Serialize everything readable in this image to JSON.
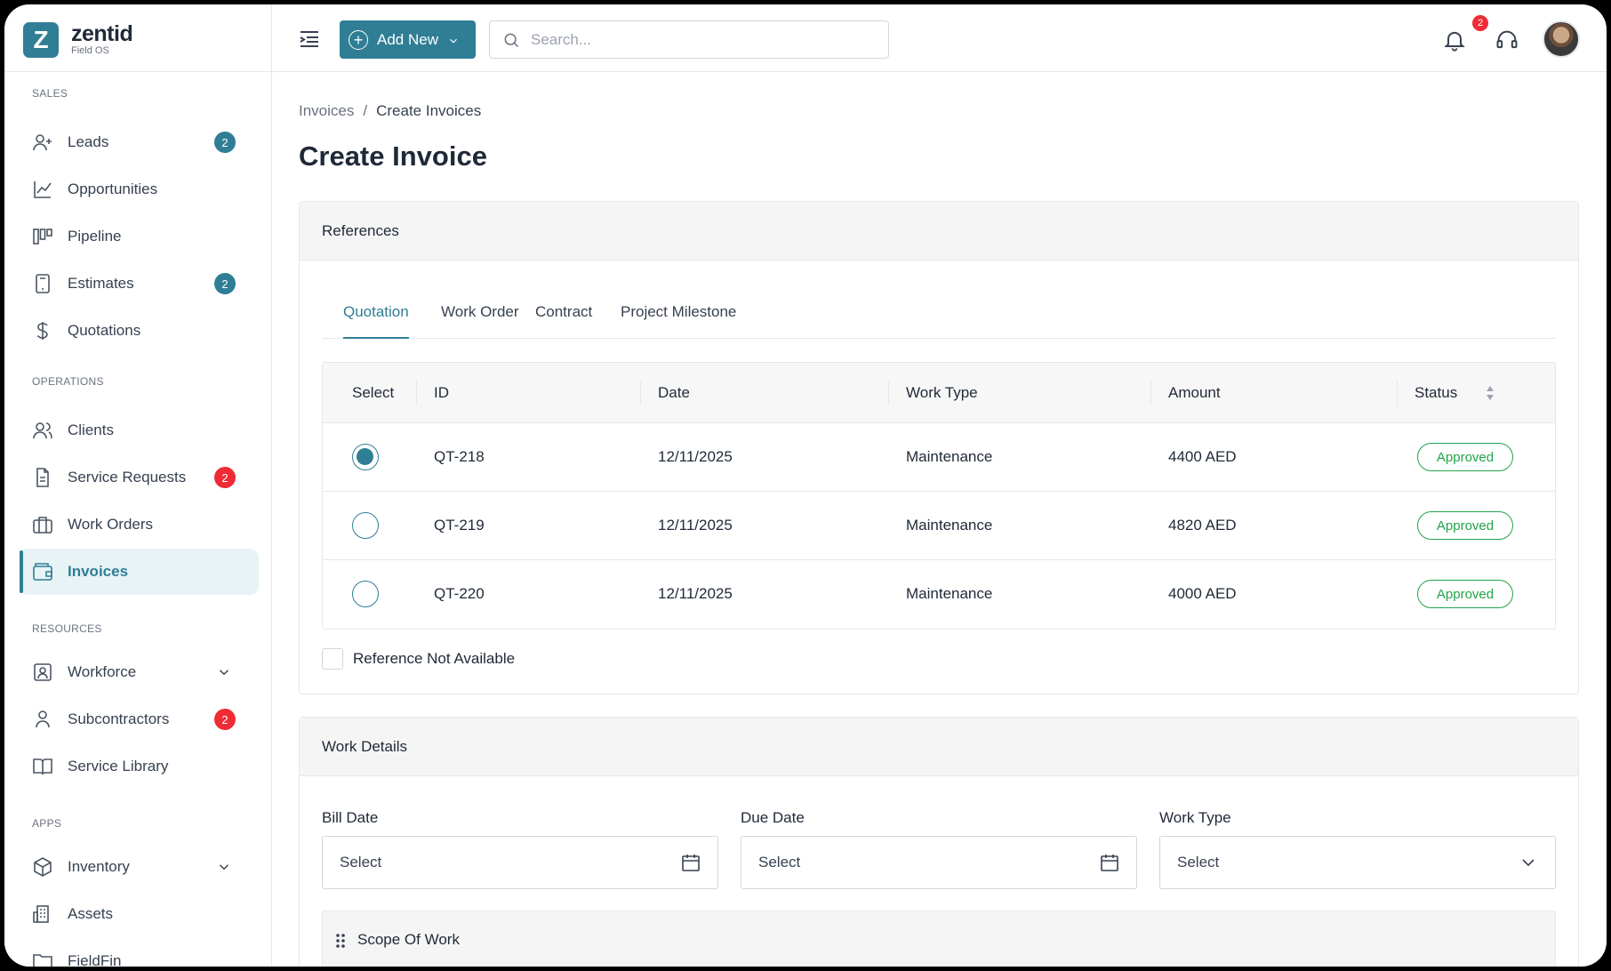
{
  "brand": {
    "logo_letter": "Z",
    "name": "zentid",
    "sub": "Field OS"
  },
  "sidebar": {
    "sections": {
      "sales": "SALES",
      "operations": "OPERATIONS",
      "resources": "RESOURCES",
      "apps": "APPS"
    },
    "items": [
      {
        "label": "Leads",
        "icon": "user-plus-icon",
        "badge": "2",
        "badge_color": "#2f7e95"
      },
      {
        "label": "Opportunities",
        "icon": "trend-chart-icon"
      },
      {
        "label": "Pipeline",
        "icon": "kanban-icon"
      },
      {
        "label": "Estimates",
        "icon": "calculator-icon",
        "badge": "2",
        "badge_color": "#2f7e95"
      },
      {
        "label": "Quotations",
        "icon": "dollar-icon"
      },
      {
        "label": "Clients",
        "icon": "users-icon"
      },
      {
        "label": "Service Requests",
        "icon": "document-icon",
        "badge": "2",
        "badge_color": "#ef2b35"
      },
      {
        "label": "Work Orders",
        "icon": "briefcase-icon"
      },
      {
        "label": "Invoices",
        "icon": "wallet-icon",
        "active": true
      },
      {
        "label": "Workforce",
        "icon": "id-card-icon",
        "expandable": true
      },
      {
        "label": "Subcontractors",
        "icon": "user-icon",
        "badge": "2",
        "badge_color": "#ef2b35"
      },
      {
        "label": "Service Library",
        "icon": "book-icon"
      },
      {
        "label": "Inventory",
        "icon": "box-icon",
        "expandable": true
      },
      {
        "label": "Assets",
        "icon": "building-icon"
      },
      {
        "label": "FieldFin",
        "icon": "folder-icon"
      }
    ]
  },
  "topbar": {
    "add_new_label": "Add New",
    "search_placeholder": "Search...",
    "notification_count": "2"
  },
  "breadcrumb": {
    "parent": "Invoices",
    "separator": "/",
    "current": "Create Invoices"
  },
  "page_title": "Create Invoice",
  "references": {
    "title": "References",
    "tabs": [
      "Quotation",
      "Work Order",
      "Contract",
      "Project Milestone"
    ],
    "active_tab": "Quotation",
    "columns": [
      "Select",
      "ID",
      "Date",
      "Work Type",
      "Amount",
      "Status"
    ],
    "rows": [
      {
        "id": "QT-218",
        "date": "12/11/2025",
        "work_type": "Maintenance",
        "amount": "4400 AED",
        "status": "Approved",
        "selected": true
      },
      {
        "id": "QT-219",
        "date": "12/11/2025",
        "work_type": "Maintenance",
        "amount": "4820 AED",
        "status": "Approved",
        "selected": false
      },
      {
        "id": "QT-220",
        "date": "12/11/2025",
        "work_type": "Maintenance",
        "amount": "4000 AED",
        "status": "Approved",
        "selected": false
      }
    ],
    "ref_not_available_label": "Reference Not Available"
  },
  "work_details": {
    "title": "Work Details",
    "bill_date": {
      "label": "Bill Date",
      "value": "Select"
    },
    "due_date": {
      "label": "Due Date",
      "value": "Select"
    },
    "work_type": {
      "label": "Work Type",
      "value": "Select"
    },
    "scope_label": "Scope Of Work"
  },
  "colors": {
    "accent": "#2f7e95",
    "danger": "#ef2b35",
    "success": "#22a34a"
  }
}
